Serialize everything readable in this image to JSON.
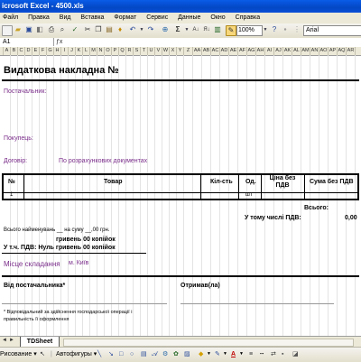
{
  "window": {
    "title": "icrosoft Excel - 4500.xls"
  },
  "menu": [
    "Файл",
    "Правка",
    "Вид",
    "Вставка",
    "Формат",
    "Сервис",
    "Данные",
    "Окно",
    "Справка"
  ],
  "toolbar": {
    "zoom": "100%",
    "font": "Arial"
  },
  "formula_bar": {
    "name_box": "A1"
  },
  "columns": [
    "A",
    "B",
    "C",
    "D",
    "E",
    "F",
    "G",
    "H",
    "I",
    "J",
    "K",
    "L",
    "M",
    "N",
    "O",
    "P",
    "Q",
    "R",
    "S",
    "T",
    "U",
    "V",
    "W",
    "X",
    "Y",
    "Z",
    "AA",
    "AB",
    "AC",
    "AD",
    "AE",
    "AF",
    "AG",
    "AH",
    "AI",
    "AJ",
    "AK",
    "AL",
    "AM",
    "AN",
    "AO",
    "AP",
    "AQ",
    "AR"
  ],
  "sheet": {
    "title": "Видаткова накладна №",
    "supplier_label": "Постачальник:",
    "buyer_label": "Покупець:",
    "contract_label": "Договір:",
    "contract_value": "По розрахункових документах",
    "table": {
      "headers": [
        "№",
        "Товар",
        "Кіл-сть",
        "Од.",
        "Ціна без ПДВ",
        "Сума без ПДВ"
      ],
      "row": {
        "num": "1",
        "unit": "шт"
      }
    },
    "total_label": "Всього:",
    "vat_label": "У тому числі ПДВ:",
    "vat_value": "0,00",
    "items_line": "Всього найменувань __ на суму __,00 грн.",
    "amount_words": "гривень 00 копійок",
    "vat_words": "У т.ч. ПДВ: Нуль гривень 00 копійок",
    "place_label": "Місце складання",
    "place_value": "м. Київ",
    "from_label": "Від постачальника*",
    "received_label": "Отримав(ла)",
    "footnote1": "* Відповідальний за здійснення господарської операції і",
    "footnote2": "правильність її оформлення"
  },
  "sheet_tab": "TDSheet",
  "drawing_toolbar": {
    "draw_label": "Рисование",
    "autoshapes_label": "Автофигуры"
  }
}
